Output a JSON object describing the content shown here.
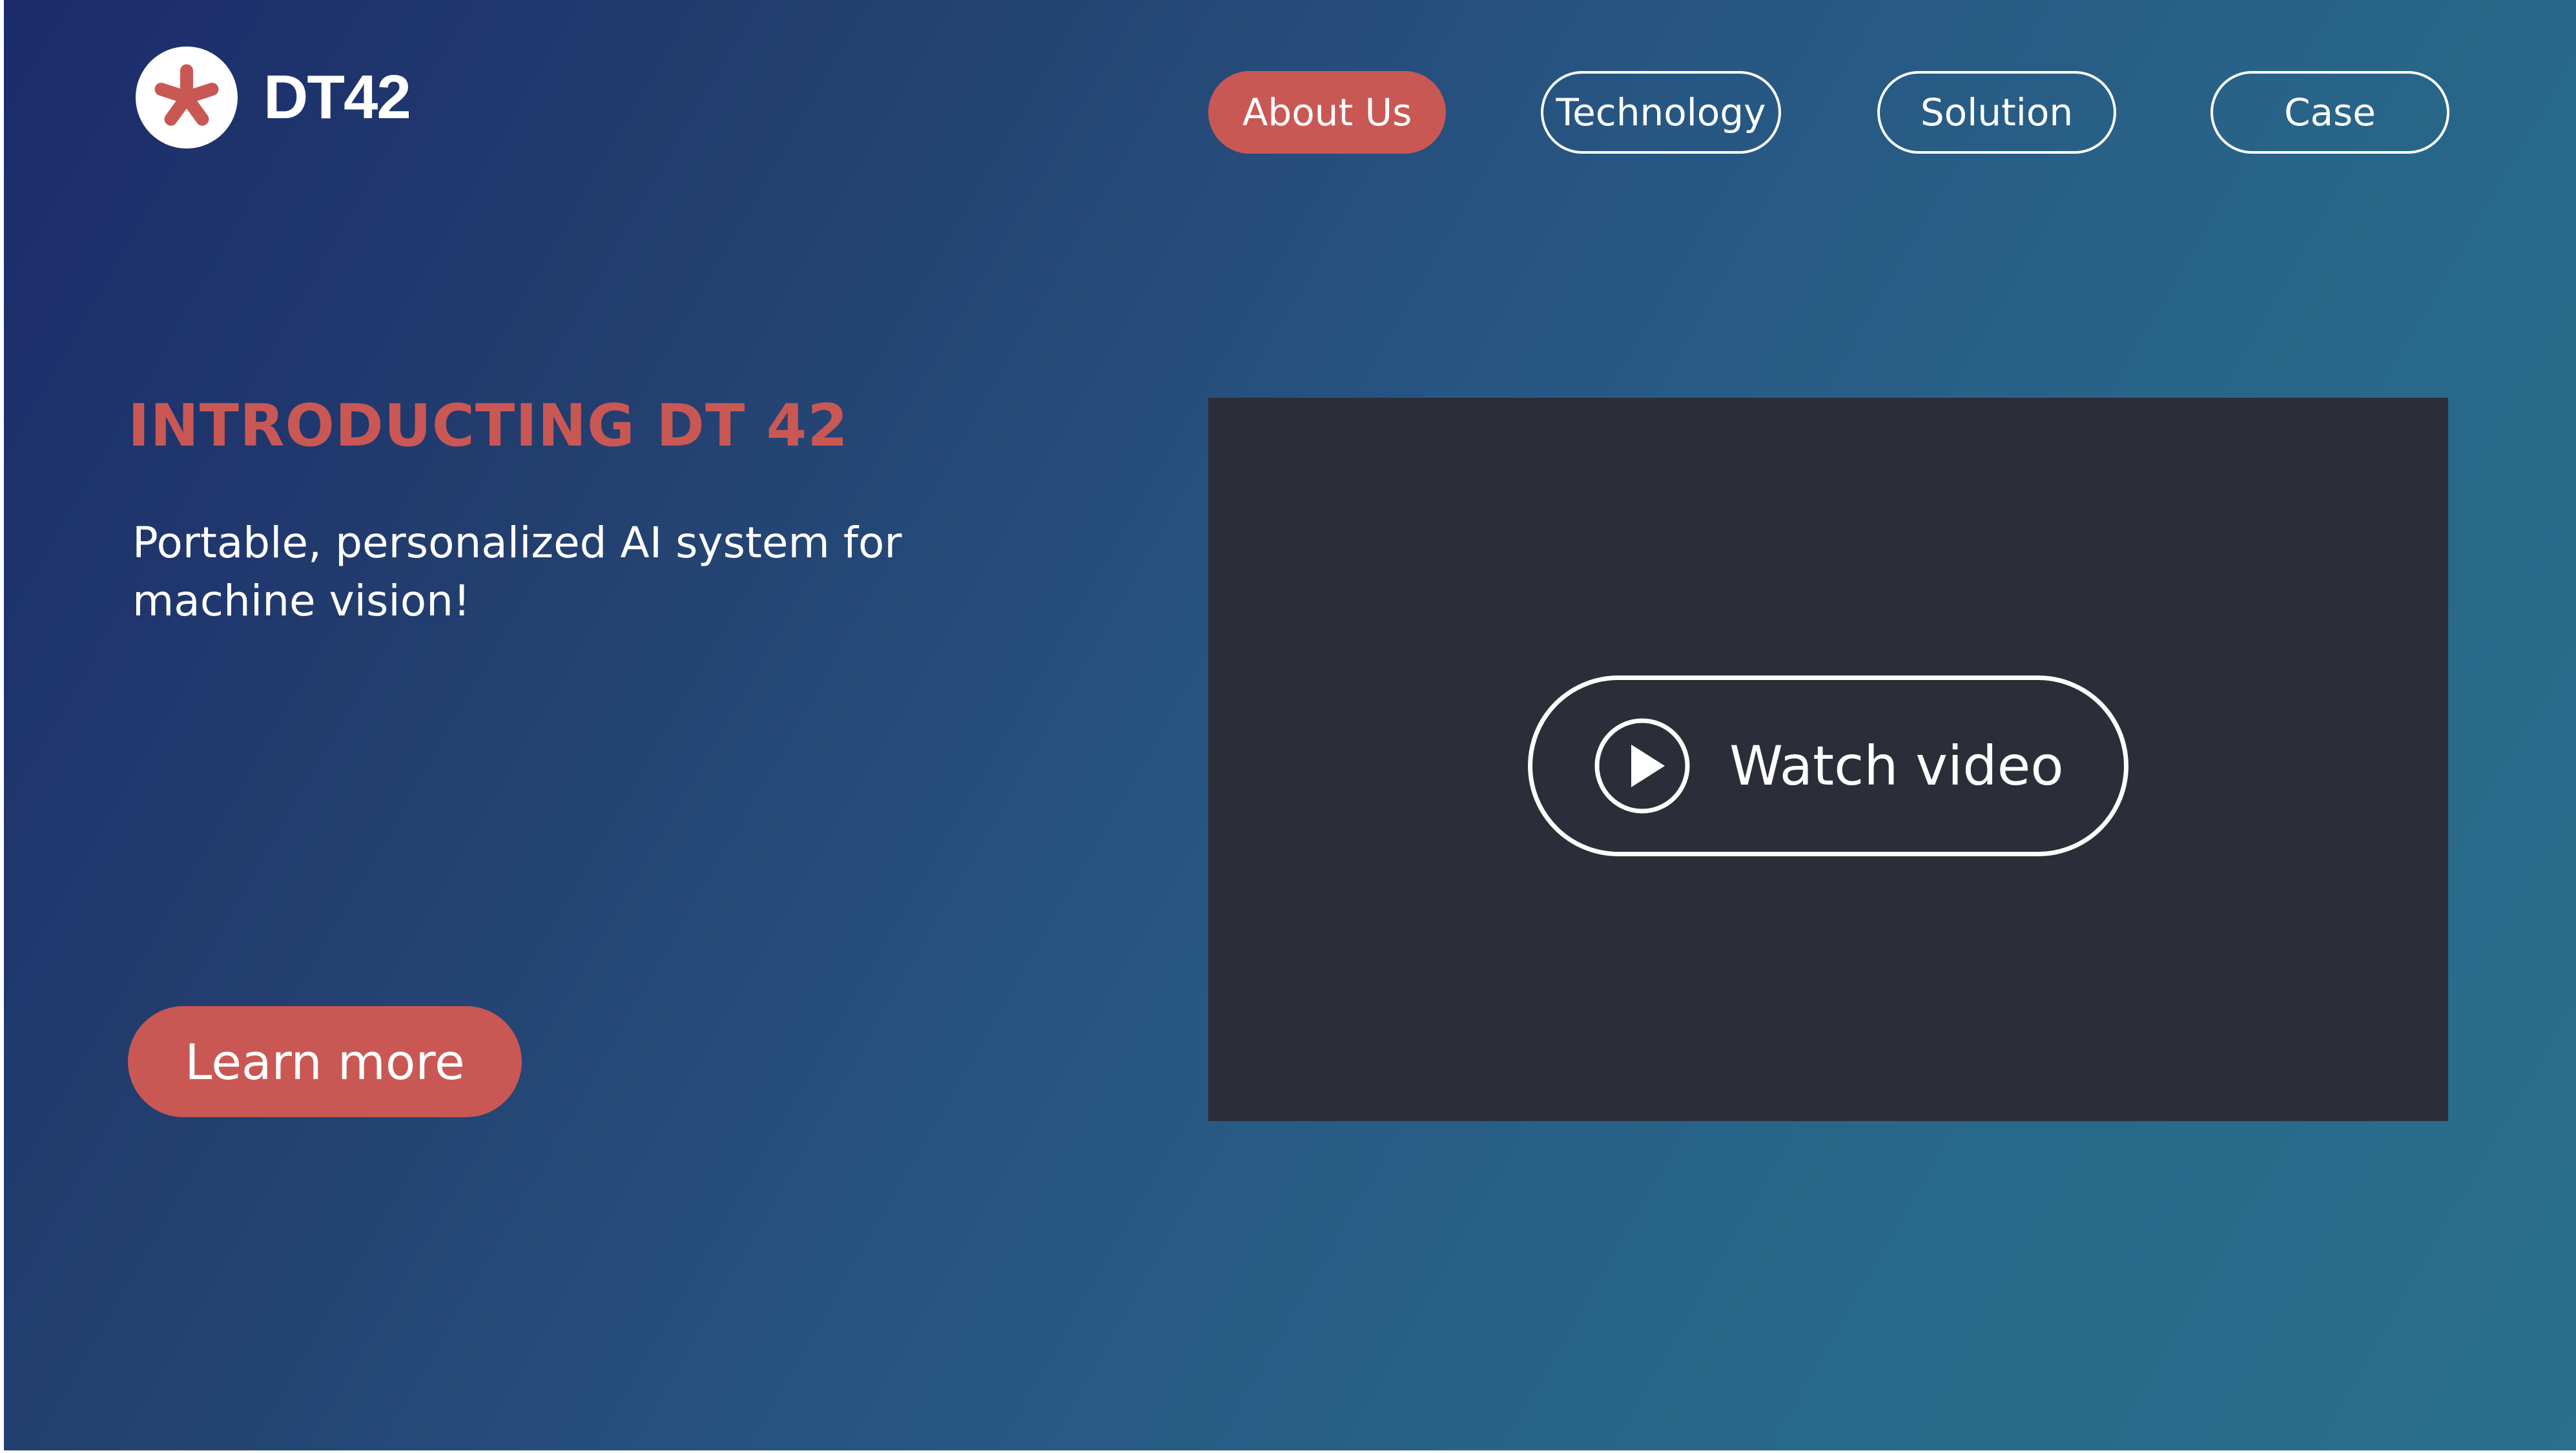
{
  "brand": {
    "name": "DT42",
    "logo_icon": "asterisk-icon"
  },
  "nav": {
    "items": [
      {
        "label": "About Us",
        "active": true
      },
      {
        "label": "Technology",
        "active": false
      },
      {
        "label": "Solution",
        "active": false
      },
      {
        "label": "Case",
        "active": false
      }
    ]
  },
  "hero": {
    "title": "INTRODUCTING DT 42",
    "subtitle_line1": "Portable, personalized AI system for",
    "subtitle_line2": "machine vision!",
    "cta_label": "Learn more"
  },
  "video": {
    "button_label": "Watch video",
    "button_icon": "play-icon"
  },
  "colors": {
    "accent": "#c95854",
    "background_start": "#1b2b6b",
    "background_end": "#2a6f8e",
    "video_panel": "#2b2e38",
    "text": "#ffffff"
  }
}
